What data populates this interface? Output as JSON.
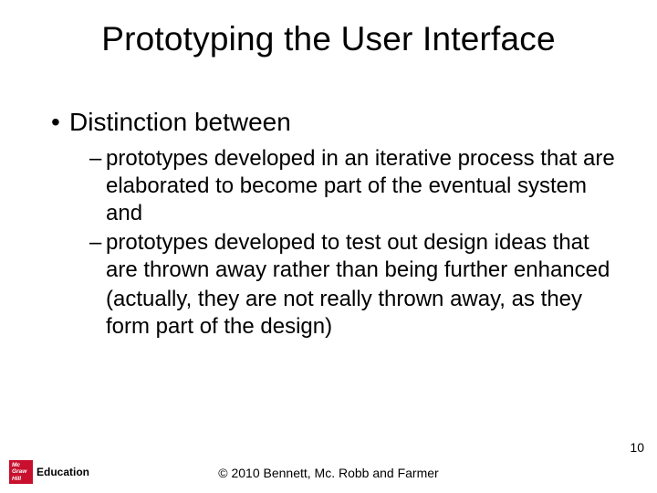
{
  "title": "Prototyping the User Interface",
  "bullets": {
    "lvl1": "Distinction between",
    "lvl2a": "prototypes developed in an iterative process that are elaborated to become part of the eventual system and",
    "lvl2b": "prototypes developed to test out design ideas that are thrown away rather than being further enhanced",
    "lvl2b_note": "(actually, they are not really thrown away, as they form part of the design)"
  },
  "page_number": "10",
  "copyright": "© 2010 Bennett, Mc. Robb and Farmer",
  "logo": {
    "line1": "Mc",
    "line2": "Graw",
    "line3": "Hill",
    "brand": "Education"
  }
}
